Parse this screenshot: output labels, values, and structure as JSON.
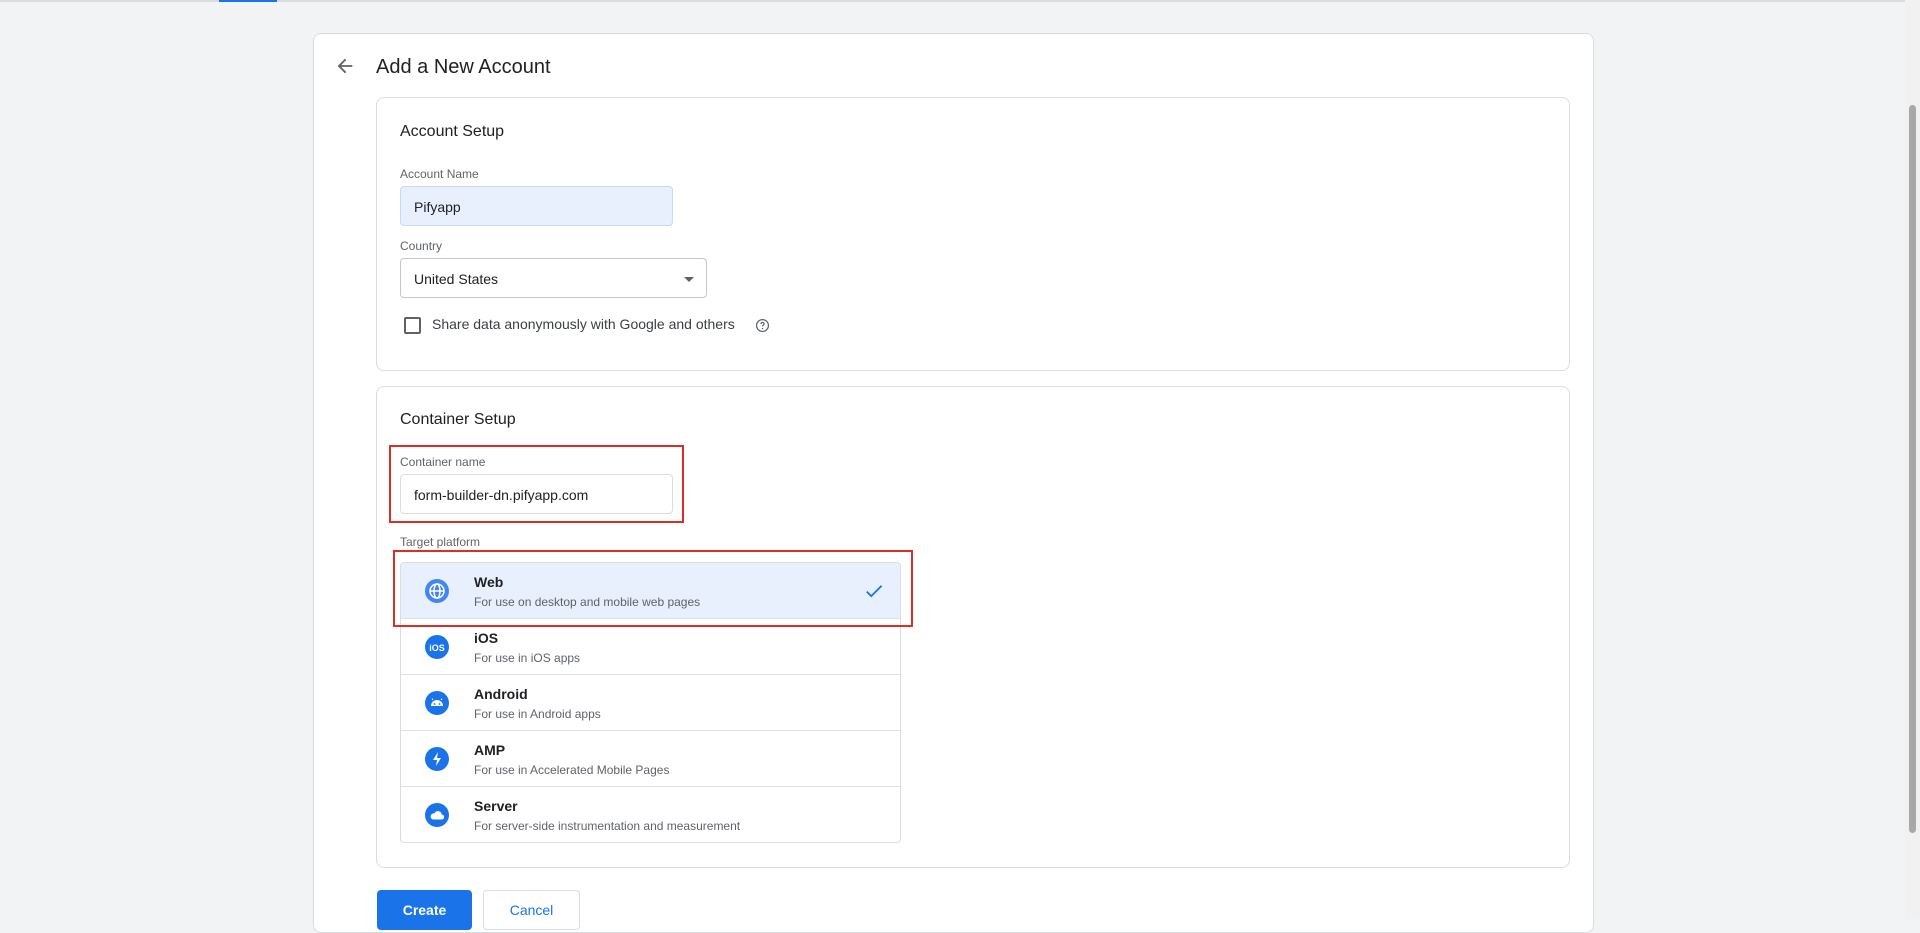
{
  "page": {
    "title": "Add a New Account"
  },
  "account_setup": {
    "title": "Account Setup",
    "account_name_label": "Account Name",
    "account_name_value": "Pifyapp",
    "country_label": "Country",
    "country_value": "United States",
    "share_data_label": "Share data anonymously with Google and others",
    "share_data_checked": false
  },
  "container_setup": {
    "title": "Container Setup",
    "container_name_label": "Container name",
    "container_name_value": "form-builder-dn.pifyapp.com",
    "target_platform_label": "Target platform",
    "platforms": [
      {
        "name": "Web",
        "desc": "For use on desktop and mobile web pages",
        "icon": "globe-icon",
        "selected": true
      },
      {
        "name": "iOS",
        "desc": "For use in iOS apps",
        "icon": "ios-icon",
        "selected": false
      },
      {
        "name": "Android",
        "desc": "For use in Android apps",
        "icon": "android-icon",
        "selected": false
      },
      {
        "name": "AMP",
        "desc": "For use in Accelerated Mobile Pages",
        "icon": "lightning-icon",
        "selected": false
      },
      {
        "name": "Server",
        "desc": "For server-side instrumentation and measurement",
        "icon": "cloud-icon",
        "selected": false
      }
    ]
  },
  "actions": {
    "create_label": "Create",
    "cancel_label": "Cancel"
  },
  "colors": {
    "accent": "#1a73e8",
    "highlight": "#d93025",
    "selected_bg": "#e8f0fe"
  }
}
